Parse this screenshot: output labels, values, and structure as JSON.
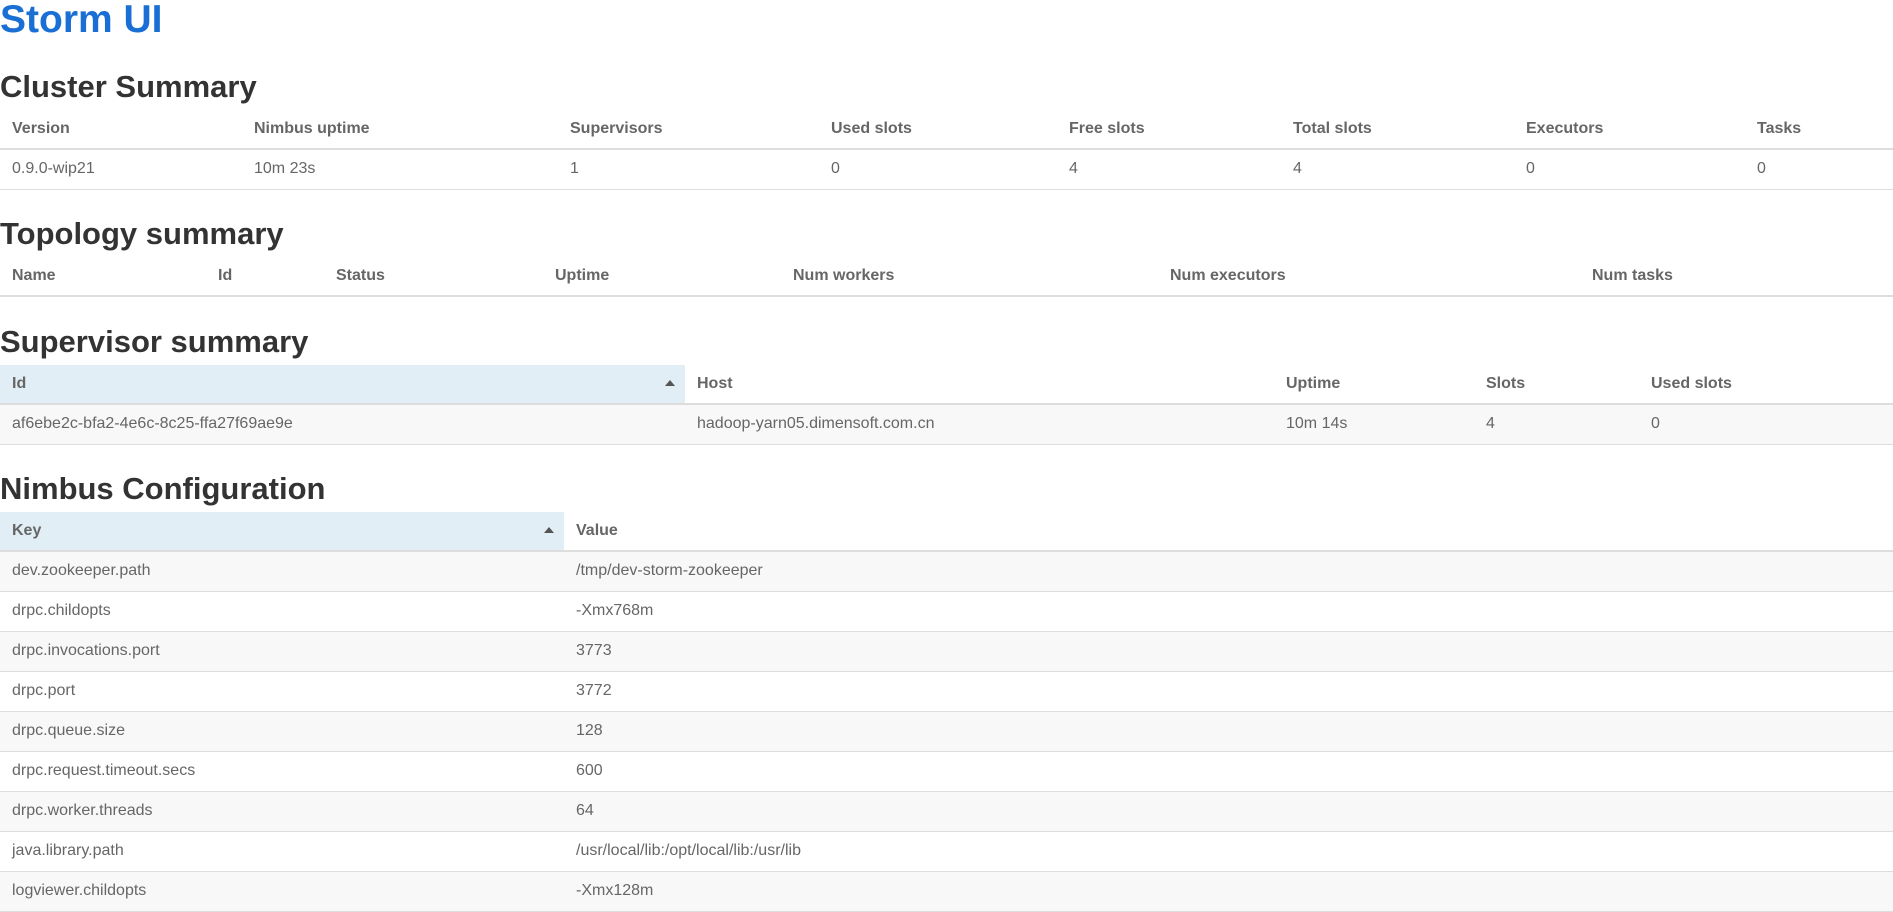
{
  "app": {
    "title": "Storm UI"
  },
  "cluster": {
    "title": "Cluster Summary",
    "headers": [
      "Version",
      "Nimbus uptime",
      "Supervisors",
      "Used slots",
      "Free slots",
      "Total slots",
      "Executors",
      "Tasks"
    ],
    "row": [
      "0.9.0-wip21",
      "10m 23s",
      "1",
      "0",
      "4",
      "4",
      "0",
      "0"
    ]
  },
  "topology": {
    "title": "Topology summary",
    "headers": [
      "Name",
      "Id",
      "Status",
      "Uptime",
      "Num workers",
      "Num executors",
      "Num tasks"
    ]
  },
  "supervisor": {
    "title": "Supervisor summary",
    "headers": [
      "Id",
      "Host",
      "Uptime",
      "Slots",
      "Used slots"
    ],
    "row": [
      "af6ebe2c-bfa2-4e6c-8c25-ffa27f69ae9e",
      "hadoop-yarn05.dimensoft.com.cn",
      "10m 14s",
      "4",
      "0"
    ]
  },
  "nimbus": {
    "title": "Nimbus Configuration",
    "headers": [
      "Key",
      "Value"
    ],
    "rows": [
      [
        "dev.zookeeper.path",
        "/tmp/dev-storm-zookeeper"
      ],
      [
        "drpc.childopts",
        "-Xmx768m"
      ],
      [
        "drpc.invocations.port",
        "3773"
      ],
      [
        "drpc.port",
        "3772"
      ],
      [
        "drpc.queue.size",
        "128"
      ],
      [
        "drpc.request.timeout.secs",
        "600"
      ],
      [
        "drpc.worker.threads",
        "64"
      ],
      [
        "java.library.path",
        "/usr/local/lib:/opt/local/lib:/usr/lib"
      ],
      [
        "logviewer.childopts",
        "-Xmx128m"
      ]
    ]
  },
  "colors": {
    "title": "#1a6fd4",
    "sorted_header": "#e2eef5",
    "stripe": "#f8f8f8",
    "border": "#dddddd"
  }
}
